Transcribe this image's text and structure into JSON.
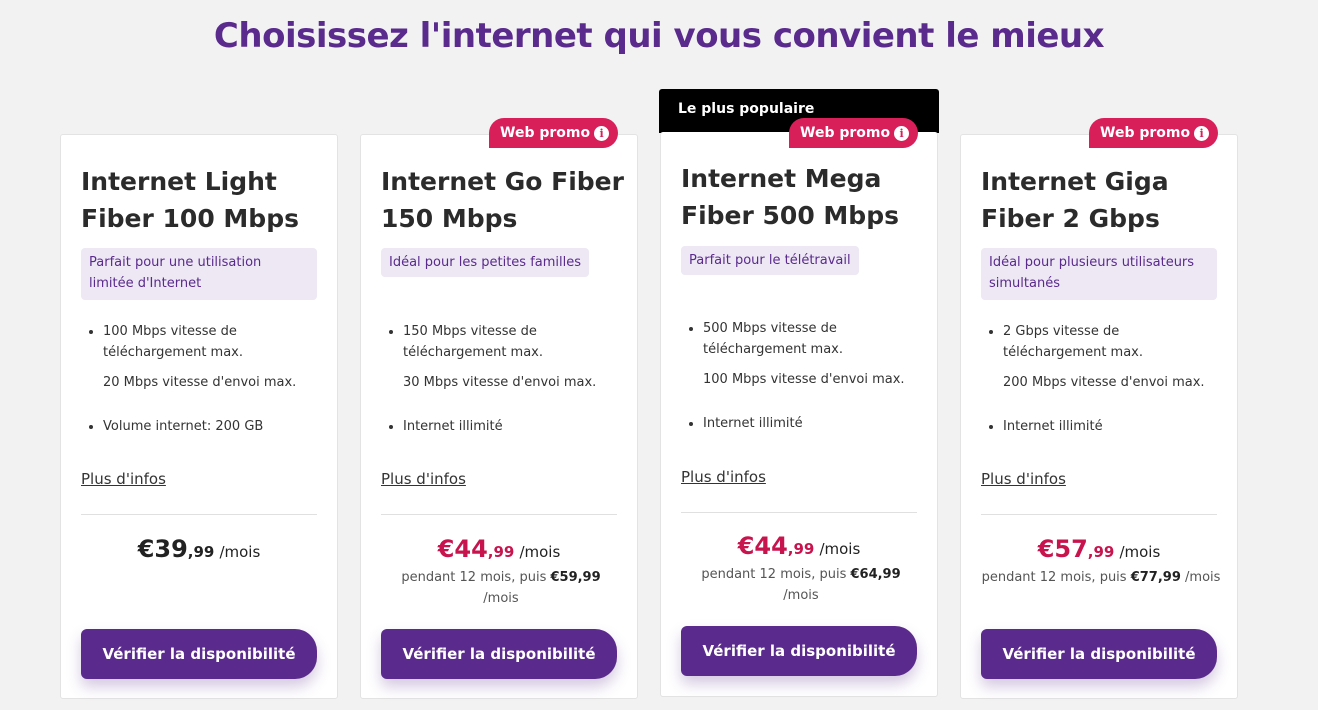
{
  "page_title": "Choisissez l'internet qui vous convient le mieux",
  "popular_banner": "Le plus populaire",
  "promo_badge": "Web promo",
  "more_info": "Plus d'infos",
  "cta_label": "Vérifier la disponibilité",
  "colors": {
    "brand_purple": "#5a2a8c",
    "promo_pink": "#d81f5a",
    "price_red": "#c8144e"
  },
  "plans": [
    {
      "name": "Internet Light Fiber 100 Mbps",
      "tag": "Parfait pour une utilisation limitée d'Internet",
      "features": [
        "100 Mbps vitesse de téléchargement max.",
        "20 Mbps vitesse d'envoi max.",
        "Volume internet: 200 GB"
      ],
      "price": {
        "euro": "€39",
        "cents": ",99",
        "per": "/mois"
      }
    },
    {
      "name": "Internet Go Fiber 150 Mbps",
      "tag": "Idéal pour les petites familles",
      "features": [
        "150 Mbps vitesse de téléchargement max.",
        "30 Mbps vitesse d'envoi max.",
        "Internet illimité"
      ],
      "price": {
        "euro": "€44",
        "cents": ",99",
        "per": "/mois"
      },
      "price_note": {
        "before": "pendant 12 mois, puis",
        "after_price": "€59,99",
        "after_per": "/mois"
      }
    },
    {
      "name": "Internet Mega Fiber 500 Mbps",
      "tag": "Parfait pour le télétravail",
      "features": [
        "500 Mbps vitesse de téléchargement max.",
        "100 Mbps vitesse d'envoi max.",
        "Internet illimité"
      ],
      "price": {
        "euro": "€44",
        "cents": ",99",
        "per": "/mois"
      },
      "price_note": {
        "before": "pendant 12 mois, puis",
        "after_price": "€64,99",
        "after_per": "/mois"
      }
    },
    {
      "name": "Internet Giga Fiber 2 Gbps",
      "tag": "Idéal pour plusieurs utilisateurs simultanés",
      "features": [
        "2 Gbps vitesse de téléchargement max.",
        "200 Mbps vitesse d'envoi max.",
        "Internet illimité"
      ],
      "price": {
        "euro": "€57",
        "cents": ",99",
        "per": "/mois"
      },
      "price_note": {
        "before": "pendant 12 mois, puis",
        "after_price": "€77,99",
        "after_per": "/mois"
      }
    }
  ]
}
